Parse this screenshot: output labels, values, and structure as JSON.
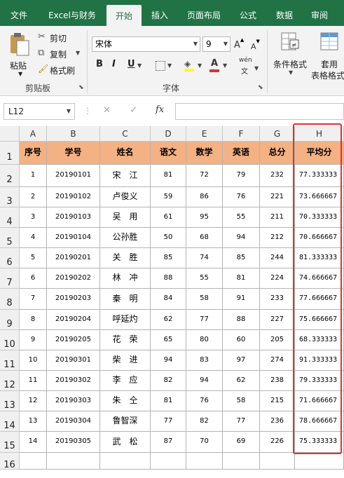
{
  "tabs": [
    "文件",
    "Excel与财务",
    "开始",
    "插入",
    "页面布局",
    "公式",
    "数据",
    "审阅"
  ],
  "ribbon": {
    "paste": "粘贴",
    "cut": "剪切",
    "copy": "复制",
    "format_painter": "格式刷",
    "clipboard_group": "剪贴板",
    "font_name": "宋体",
    "font_size": "9",
    "grow_font": "A",
    "shrink_font": "A",
    "bold": "B",
    "italic": "I",
    "underline": "U",
    "phonetic": "wén",
    "font_group": "字体",
    "conditional_format": "条件格式",
    "table_format_line1": "套用",
    "table_format_line2": "表格格式"
  },
  "formula_bar": {
    "name_box": "L12",
    "cancel": "✕",
    "enter": "✓",
    "fx": "fx",
    "formula": ""
  },
  "sheet": {
    "columns": [
      "A",
      "B",
      "C",
      "D",
      "E",
      "F",
      "G",
      "H"
    ],
    "row_numbers": [
      "1",
      "2",
      "3",
      "4",
      "5",
      "6",
      "7",
      "8",
      "9",
      "10",
      "11",
      "12",
      "13",
      "14",
      "15",
      "16"
    ],
    "headers": [
      "序号",
      "学号",
      "姓名",
      "语文",
      "数学",
      "英语",
      "总分",
      "平均分"
    ],
    "rows": [
      [
        "1",
        "20190101",
        "宋　江",
        "81",
        "72",
        "79",
        "232",
        "77.333333"
      ],
      [
        "2",
        "20190102",
        "卢俊义",
        "59",
        "86",
        "76",
        "221",
        "73.666667"
      ],
      [
        "3",
        "20190103",
        "吴　用",
        "61",
        "95",
        "55",
        "211",
        "70.333333"
      ],
      [
        "4",
        "20190104",
        "公孙胜",
        "50",
        "68",
        "94",
        "212",
        "70.666667"
      ],
      [
        "5",
        "20190201",
        "关　胜",
        "85",
        "74",
        "85",
        "244",
        "81.333333"
      ],
      [
        "6",
        "20190202",
        "林　冲",
        "88",
        "55",
        "81",
        "224",
        "74.666667"
      ],
      [
        "7",
        "20190203",
        "秦　明",
        "84",
        "58",
        "91",
        "233",
        "77.666667"
      ],
      [
        "8",
        "20190204",
        "呼延灼",
        "62",
        "77",
        "88",
        "227",
        "75.666667"
      ],
      [
        "9",
        "20190205",
        "花　荣",
        "65",
        "80",
        "60",
        "205",
        "68.333333"
      ],
      [
        "10",
        "20190301",
        "柴　进",
        "94",
        "83",
        "97",
        "274",
        "91.333333"
      ],
      [
        "11",
        "20190302",
        "李　应",
        "82",
        "94",
        "62",
        "238",
        "79.333333"
      ],
      [
        "12",
        "20190303",
        "朱　仝",
        "81",
        "76",
        "58",
        "215",
        "71.666667"
      ],
      [
        "13",
        "20190304",
        "鲁智深",
        "77",
        "82",
        "77",
        "236",
        "78.666667"
      ],
      [
        "14",
        "20190305",
        "武　松",
        "87",
        "70",
        "69",
        "226",
        "75.333333"
      ]
    ]
  },
  "colors": {
    "ribbon_green": "#217346",
    "header_fill": "#f4b183",
    "highlight_border": "#e0312b"
  }
}
